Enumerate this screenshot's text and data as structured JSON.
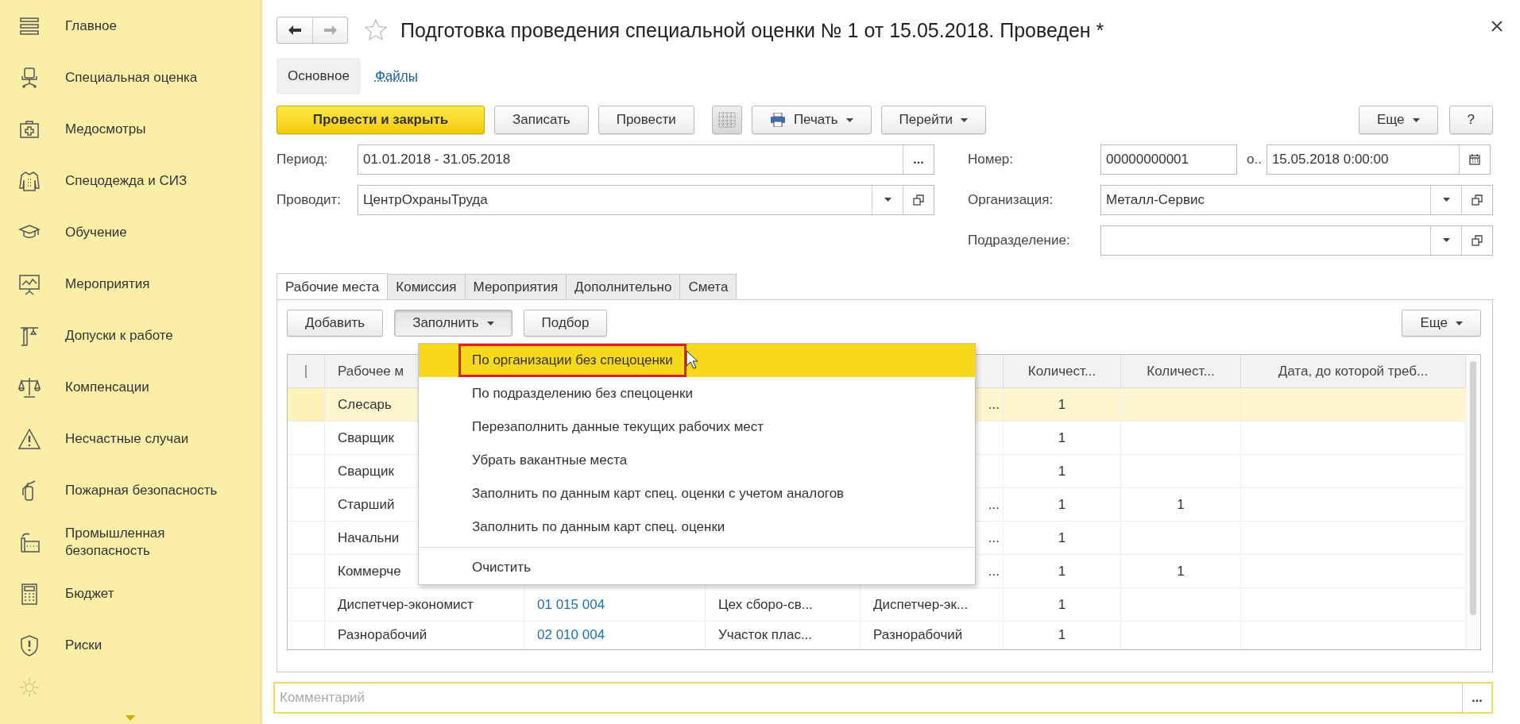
{
  "sidebar": {
    "items": [
      {
        "label": "Главное"
      },
      {
        "label": "Специальная оценка"
      },
      {
        "label": "Медосмотры"
      },
      {
        "label": "Спецодежда и СИЗ"
      },
      {
        "label": "Обучение"
      },
      {
        "label": "Мероприятия"
      },
      {
        "label": "Допуски к работе"
      },
      {
        "label": "Компенсации"
      },
      {
        "label": "Несчастные случаи"
      },
      {
        "label": "Пожарная безопасность"
      },
      {
        "label": "Промышленная безопасность"
      },
      {
        "label": "Бюджет"
      },
      {
        "label": "Риски"
      }
    ]
  },
  "window": {
    "title": "Подготовка проведения специальной оценки № 1 от 15.05.2018. Проведен *"
  },
  "nav_tabs": [
    {
      "label": "Основное",
      "selected": true
    },
    {
      "label": "Файлы",
      "selected": false
    }
  ],
  "toolbar": {
    "buttons": [
      {
        "label": "Провести и закрыть",
        "kind": "primary"
      },
      {
        "label": "Записать",
        "kind": "plain"
      },
      {
        "label": "Провести",
        "kind": "plain"
      },
      {
        "kind": "icon"
      },
      {
        "label": "Печать",
        "kind": "print"
      },
      {
        "label": "Перейти",
        "kind": "dropdown"
      }
    ],
    "right": [
      {
        "label": "Еще",
        "kind": "dropdown"
      },
      {
        "label": "?",
        "kind": "plain"
      }
    ]
  },
  "left_fields": [
    {
      "label": "Период:",
      "value": "01.01.2018 - 31.05.2018",
      "kind": "select",
      "button": "..."
    },
    {
      "label": "Проводит:",
      "value": "ЦентрОхраныТруда",
      "kind": "dropdown"
    }
  ],
  "right_fields": [
    {
      "label": "Номер:",
      "value": "00000000001",
      "kind": "number",
      "date_label": "о..",
      "date_value": "15.05.2018  0:00:00"
    },
    {
      "label": "Организация:",
      "value": "Металл-Сервис",
      "kind": "dropdown"
    },
    {
      "label": "Подразделение:",
      "kind": "dropdown"
    }
  ],
  "tabs": [
    {
      "label": "Рабочие места",
      "selected": true
    },
    {
      "label": "Комиссия",
      "selected": false
    },
    {
      "label": "Мероприятия",
      "selected": false
    },
    {
      "label": "Дополнительно",
      "selected": false
    },
    {
      "label": "Смета",
      "selected": false
    }
  ],
  "table_toolbar": {
    "buttons": [
      {
        "label": "Добавить",
        "kind": "plain",
        "expanded": false
      },
      {
        "label": "Заполнить",
        "kind": "dropdown",
        "expanded": true
      },
      {
        "label": "Подбор",
        "kind": "plain",
        "expanded": false
      }
    ],
    "right": [
      {
        "label": "Еще",
        "kind": "dropdown",
        "expanded": false
      }
    ]
  },
  "table": {
    "columns": [
      {
        "label": "Рабочее м"
      },
      {},
      {},
      {},
      {
        "label": "Количест..."
      },
      {
        "label": "Количест..."
      },
      {
        "label": "Дата, до которой треб..."
      }
    ],
    "rows": [
      {
        "selected": true,
        "cells": [
          "Слесарь",
          null,
          null,
          "...",
          "1",
          null,
          null
        ]
      },
      {
        "selected": false,
        "cells": [
          "Сварщик",
          null,
          null,
          null,
          "1",
          null,
          null
        ]
      },
      {
        "selected": false,
        "cells": [
          "Сварщик",
          null,
          null,
          null,
          "1",
          null,
          null
        ]
      },
      {
        "selected": false,
        "cells": [
          "Старший",
          null,
          null,
          "...",
          "1",
          "1",
          null
        ]
      },
      {
        "selected": false,
        "cells": [
          "Начальни",
          null,
          null,
          "...",
          "1",
          null,
          null
        ]
      },
      {
        "selected": false,
        "cells": [
          "Коммерче",
          null,
          null,
          "...",
          "1",
          "1",
          null
        ]
      },
      {
        "selected": false,
        "cells": [
          "Диспетчер-экономист",
          "01 015 004",
          "Цех сборо-св...",
          "Диспетчер-эк...",
          "1",
          null,
          null
        ]
      },
      {
        "selected": false,
        "cells": [
          "Разнорабочий",
          "02 010 004",
          "Участок плас...",
          "Разнорабочий",
          "1",
          null,
          null
        ]
      }
    ]
  },
  "menu": {
    "items": [
      {
        "kind": "item",
        "label": "По организации без спецоценки",
        "selected": true
      },
      {
        "kind": "item",
        "label": "По подразделению без спецоценки",
        "selected": false
      },
      {
        "kind": "item",
        "label": "Перезаполнить данные текущих рабочих мест",
        "selected": false
      },
      {
        "kind": "item",
        "label": "Убрать вакантные места",
        "selected": false
      },
      {
        "kind": "item",
        "label": "Заполнить по данным карт спец. оценки с учетом аналогов",
        "selected": false
      },
      {
        "kind": "item",
        "label": "Заполнить по данным карт спец. оценки",
        "selected": false
      },
      {
        "kind": "separator"
      },
      {
        "kind": "item",
        "label": "Очистить",
        "selected": false
      }
    ]
  },
  "comment": {
    "placeholder": "Комментарий",
    "button": "..."
  }
}
